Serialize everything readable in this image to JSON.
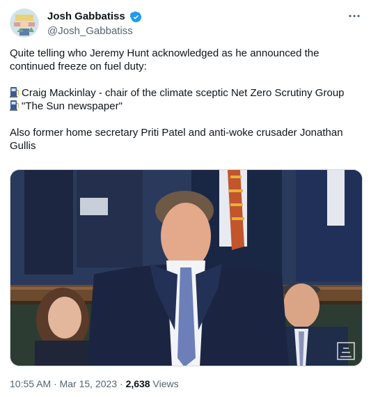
{
  "author": {
    "display_name": "Josh Gabbatiss",
    "handle": "@Josh_Gabbatiss",
    "verified_icon": "verified-badge-icon",
    "accent": "#1d9bf0"
  },
  "tweet": {
    "line1": "Quite telling who Jeremy Hunt acknowledged as he announced the continued freeze on fuel duty:",
    "item1": "Craig Mackinlay -  chair of the climate sceptic Net Zero Scrutiny Group",
    "item2": "\"The Sun newspaper\"",
    "line2": "Also former home secretary Priti Patel and anti-woke crusader Jonathan Gullis",
    "bullet_icon": "fuel-pump-icon"
  },
  "meta": {
    "time": "10:55 AM",
    "sep1": " · ",
    "date": "Mar 15, 2023",
    "sep2": " · ",
    "views_count": "2,638",
    "views_label": " Views"
  },
  "more_icon": "more-options-icon"
}
